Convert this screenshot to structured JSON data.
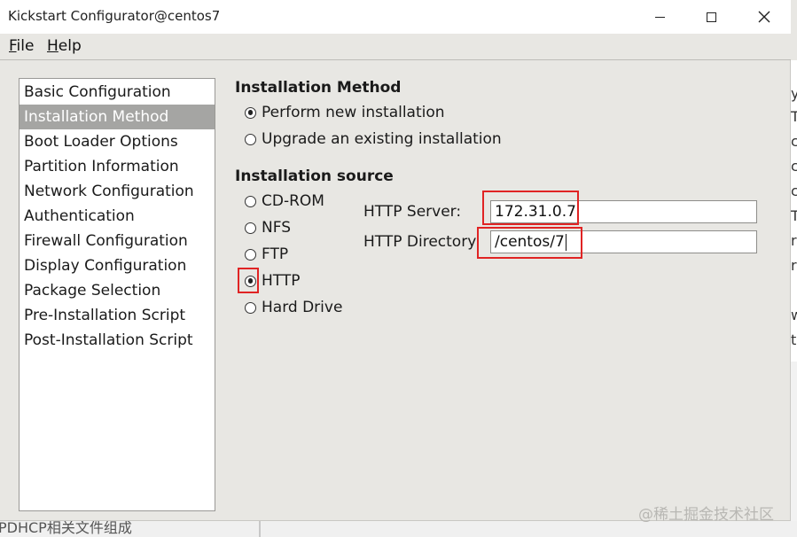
{
  "window": {
    "title": "Kickstart Configurator@centos7",
    "controls": [
      "minimize",
      "maximize",
      "close"
    ]
  },
  "menu": [
    {
      "label": "File",
      "mnemonic": "F",
      "rest": "ile"
    },
    {
      "label": "Help",
      "mnemonic": "H",
      "rest": "elp"
    }
  ],
  "sidebar": {
    "items": [
      {
        "label": "Basic Configuration",
        "selected": false
      },
      {
        "label": "Installation Method",
        "selected": true
      },
      {
        "label": "Boot Loader Options",
        "selected": false
      },
      {
        "label": "Partition Information",
        "selected": false
      },
      {
        "label": "Network Configuration",
        "selected": false
      },
      {
        "label": "Authentication",
        "selected": false
      },
      {
        "label": "Firewall Configuration",
        "selected": false
      },
      {
        "label": "Display Configuration",
        "selected": false
      },
      {
        "label": "Package Selection",
        "selected": false
      },
      {
        "label": "Pre-Installation Script",
        "selected": false
      },
      {
        "label": "Post-Installation Script",
        "selected": false
      }
    ]
  },
  "install_method": {
    "heading": "Installation Method",
    "options": [
      {
        "label": "Perform new installation",
        "checked": true
      },
      {
        "label": "Upgrade an existing installation",
        "checked": false
      }
    ]
  },
  "install_source": {
    "heading": "Installation source",
    "options": [
      {
        "label": "CD-ROM",
        "checked": false
      },
      {
        "label": "NFS",
        "checked": false
      },
      {
        "label": "FTP",
        "checked": false
      },
      {
        "label": "HTTP",
        "checked": true
      },
      {
        "label": "Hard Drive",
        "checked": false
      }
    ],
    "http_server_label": "HTTP Server:",
    "http_server_value": "172.31.0.7",
    "http_directory_label": "HTTP Directory:",
    "http_directory_value": "/centos/7"
  },
  "background": {
    "right_letters": [
      "y",
      "T",
      "c",
      "c",
      "c",
      "T",
      "r",
      "r",
      "",
      "w",
      "t"
    ],
    "bottom_text": "PDHCP相关文件组成"
  },
  "watermark": "@稀土掘金技术社区",
  "colors": {
    "highlight": "#e02424",
    "selection": "#a5a5a3",
    "window_bg": "#e8e7e3"
  }
}
